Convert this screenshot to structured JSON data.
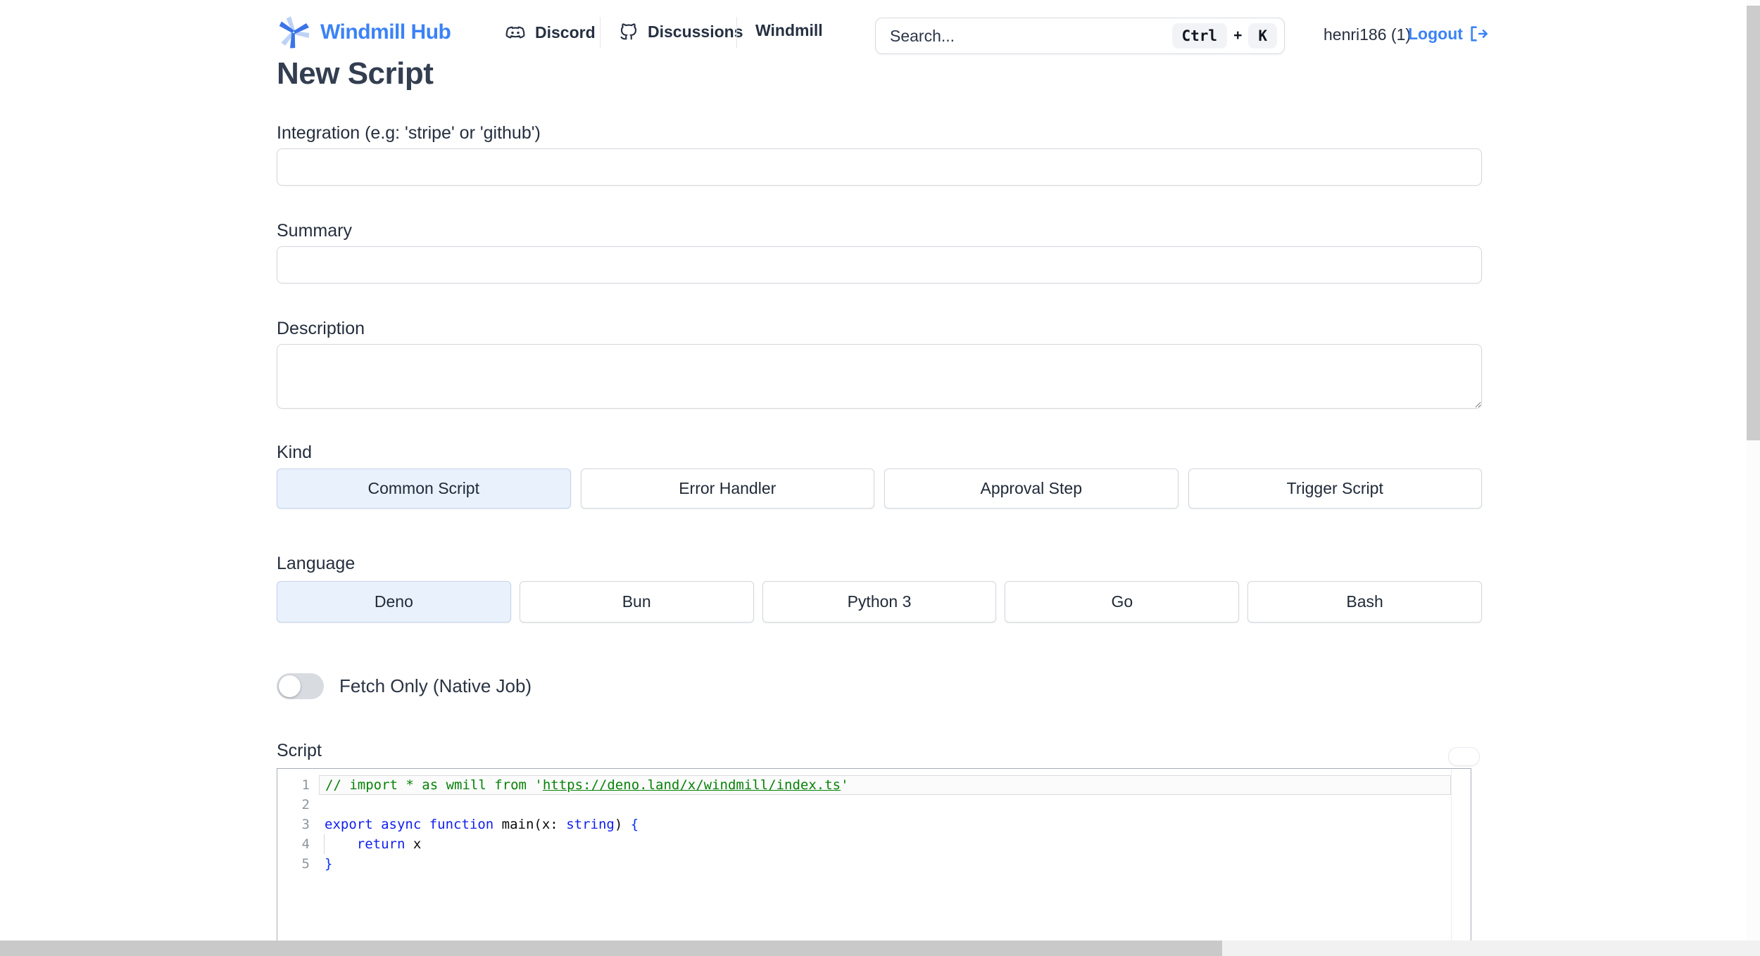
{
  "header": {
    "brand": "Windmill Hub",
    "nav": [
      {
        "label": "Discord",
        "icon": "discord-icon"
      },
      {
        "label": "Discussions",
        "icon": "github-icon"
      },
      {
        "label": "Windmill",
        "icon": null
      }
    ],
    "search": {
      "placeholder": "Search...",
      "kbd_ctrl": "Ctrl",
      "kbd_plus": "+",
      "kbd_k": "K"
    },
    "user": "henri186 (1)",
    "logout_label": "Logout"
  },
  "page": {
    "title": "New Script"
  },
  "form": {
    "integration_label": "Integration (e.g: 'stripe' or 'github')",
    "summary_label": "Summary",
    "description_label": "Description",
    "kind": {
      "label": "Kind",
      "options": [
        {
          "label": "Common Script",
          "selected": true
        },
        {
          "label": "Error Handler",
          "selected": false
        },
        {
          "label": "Approval Step",
          "selected": false
        },
        {
          "label": "Trigger Script",
          "selected": false
        }
      ]
    },
    "language": {
      "label": "Language",
      "options": [
        {
          "label": "Deno",
          "selected": true
        },
        {
          "label": "Bun",
          "selected": false
        },
        {
          "label": "Python 3",
          "selected": false
        },
        {
          "label": "Go",
          "selected": false
        },
        {
          "label": "Bash",
          "selected": false
        }
      ]
    },
    "fetch_only_label": "Fetch Only (Native Job)",
    "fetch_only_state": "off",
    "script_label": "Script"
  },
  "editor": {
    "line_numbers": [
      "1",
      "2",
      "3",
      "4",
      "5"
    ],
    "line1": {
      "comment_open": "// import * as wmill from '",
      "link": "https://deno.land/x/windmill/index.ts",
      "comment_close": "'"
    },
    "line3": {
      "kw": "export async function ",
      "fn": "main(x: ",
      "type": "string",
      "p2": ") ",
      "brace": "{"
    },
    "line4": {
      "kw": "    return ",
      "id": "x"
    },
    "line5": {
      "brace": "}"
    }
  },
  "colors": {
    "brand_blue": "#3b82f6",
    "selected_option_bg": "#e9f1fd",
    "comment_green": "#078207",
    "keyword_blue": "#0f1eee",
    "toggle_off_gray": "#d8dce1"
  }
}
